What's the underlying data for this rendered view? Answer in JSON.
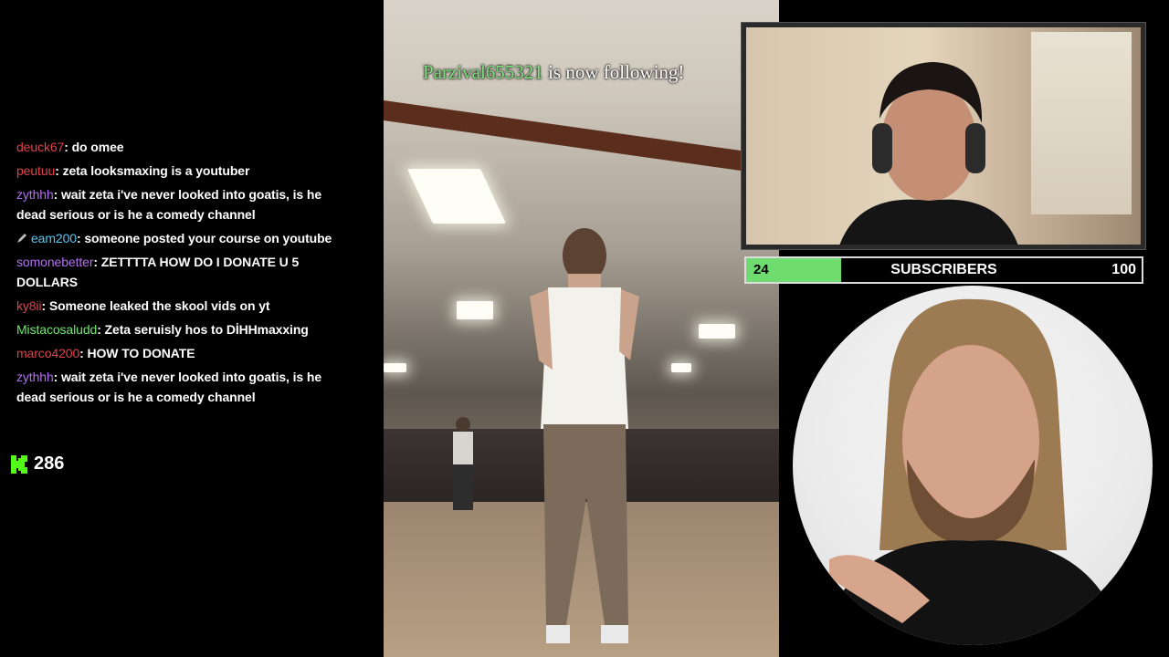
{
  "chat": {
    "messages": [
      {
        "user": "deuck67",
        "color": "#e0424a",
        "text": ": do omee",
        "badge": ""
      },
      {
        "user": "peutuu",
        "color": "#e0424a",
        "text": ": zeta looksmaxing is a youtuber",
        "badge": ""
      },
      {
        "user": "zythhh",
        "color": "#b46ff0",
        "text": ": wait zeta i've never looked into goatis, is he dead serious or is he a comedy channel",
        "badge": ""
      },
      {
        "user": "eam200",
        "color": "#5bc8f0",
        "text": ": someone posted your course on youtube",
        "badge": "pen-icon"
      },
      {
        "user": "somonebetter",
        "color": "#b46ff0",
        "text": ": ZETTTTA HOW DO I DONATE U 5 DOLLARS",
        "badge": ""
      },
      {
        "user": "ky8ii",
        "color": "#e0424a",
        "text": ": Someone leaked the skool vids on yt",
        "badge": ""
      },
      {
        "user": "Mistacosaludd",
        "color": "#6ee86e",
        "text": ": Zeta seruisly hos to DİHHmaxxing",
        "badge": ""
      },
      {
        "user": "marco4200",
        "color": "#e0424a",
        "text": ": HOW TO DONATE",
        "badge": ""
      },
      {
        "user": "zythhh",
        "color": "#b46ff0",
        "text": ": wait zeta i've never looked into goatis, is he dead serious or is he a comedy channel",
        "badge": ""
      }
    ],
    "viewer_icon": "kick-logo-icon",
    "viewer_count": "286",
    "accent": "#53fc18"
  },
  "alert": {
    "follower": "Parzival655321",
    "text": " is now following!"
  },
  "subscribers": {
    "current": "24",
    "label": "SUBSCRIBERS",
    "goal": "100",
    "progress_fraction": 0.24,
    "fill_color": "#6fdc6f"
  }
}
